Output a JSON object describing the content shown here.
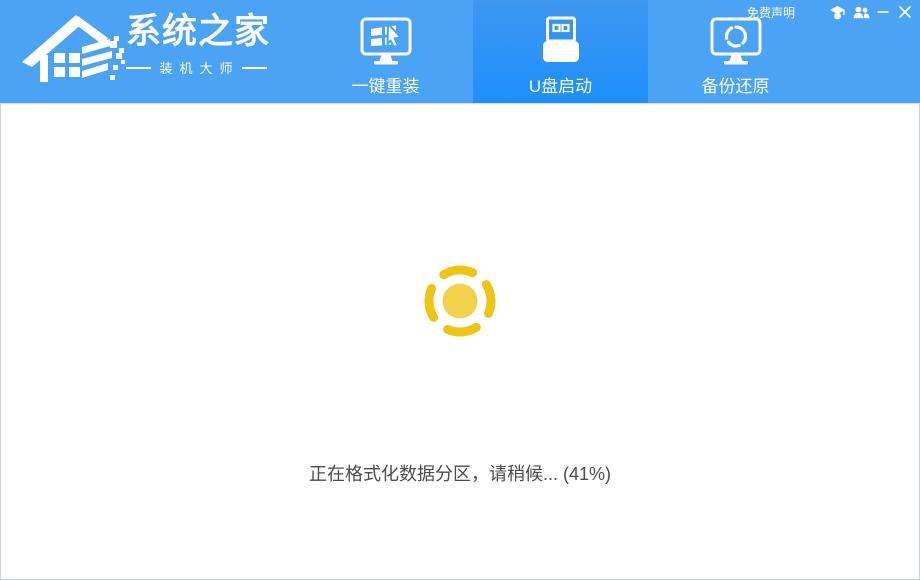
{
  "header": {
    "disclaimer": "免费声明",
    "icon_names": [
      "graduation-cap-icon",
      "users-icon",
      "minimize-icon",
      "close-icon"
    ]
  },
  "brand": {
    "name": "系统之家",
    "subtitle": "装机大师",
    "logo": "pixel-house-icon"
  },
  "tabs": [
    {
      "label": "一键重装",
      "icon": "monitor-windows-cursor-icon",
      "active": false
    },
    {
      "label": "U盘启动",
      "icon": "usb-flash-drive-icon",
      "active": true
    },
    {
      "label": "备份还原",
      "icon": "monitor-refresh-icon",
      "active": false
    }
  ],
  "main": {
    "status_text": "正在格式化数据分区，请稍候... (41%)",
    "progress_percent": 41,
    "spinner": "yellow-loading-spinner"
  },
  "colors": {
    "header_blue": "#4aa3f5",
    "active_tab_top": "#3e97f0",
    "active_tab_bottom": "#1e8ffd",
    "spinner_arc": "#efc513",
    "spinner_core": "#f2d14b",
    "status_text": "#4c4c4c",
    "body_border": "#c9d3da"
  }
}
